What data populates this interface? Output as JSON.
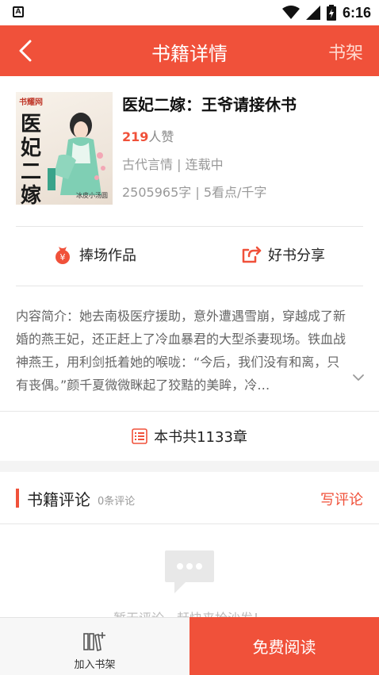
{
  "status_bar": {
    "time": "6:16",
    "left_icon": "A"
  },
  "header": {
    "title": "书籍详情",
    "shelf_label": "书架"
  },
  "book": {
    "title": "医妃二嫁：王爷请接休书",
    "likes_count": "219",
    "likes_suffix": "人赞",
    "meta": "古代言情 | 连载中",
    "stats": "2505965字 | 5看点/千字",
    "cover": {
      "brand": "书耀网",
      "title": "医妃二嫁",
      "author": "冰皮小汤圆"
    }
  },
  "actions": {
    "support_label": "捧场作品",
    "share_label": "好书分享"
  },
  "intro": {
    "text": "内容简介：她去南极医疗援助，意外遭遇雪崩，穿越成了新婚的燕王妃，还正赶上了冷血暴君的大型杀妻现场。铁血战神燕王，用利剑抵着她的喉咙：“今后，我们没有和离，只有丧偶。”颜千夏微微眯起了狡黠的美眸，冷…"
  },
  "chapters": {
    "label": "本书共1133章"
  },
  "comments": {
    "title": "书籍评论",
    "count": "0条评论",
    "write_label": "写评论",
    "empty_text": "暂无评论，赶快来抢沙发！"
  },
  "bottom_bar": {
    "add_shelf_label": "加入书架",
    "free_read_label": "免费阅读"
  },
  "colors": {
    "accent": "#f0513a"
  },
  "icons": [
    "back-icon",
    "wifi-icon",
    "signal-icon",
    "battery-icon",
    "money-bag-icon",
    "share-icon",
    "chevron-down-icon",
    "list-icon",
    "chat-bubble-icon",
    "add-to-shelf-icon"
  ]
}
